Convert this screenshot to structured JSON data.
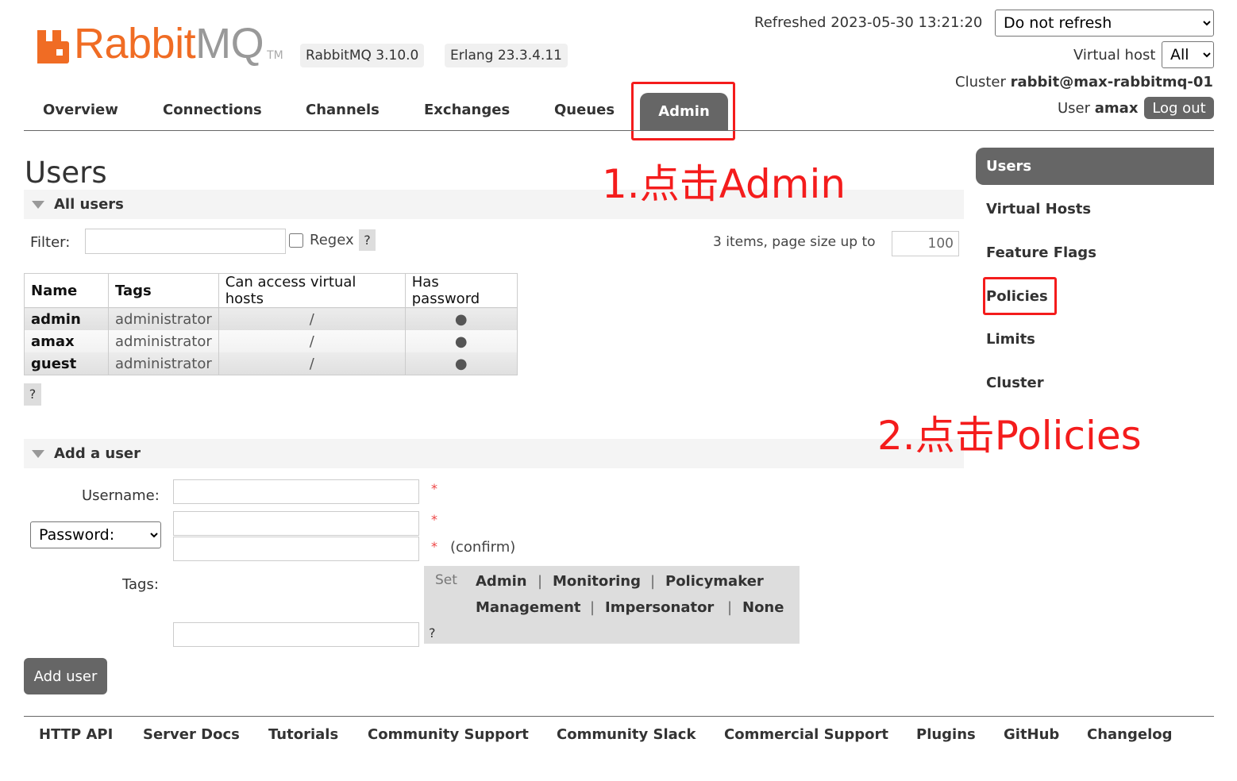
{
  "brand": {
    "name_a": "Rabbit",
    "name_b": "MQ",
    "tm": "TM"
  },
  "versions": {
    "rabbitmq": "RabbitMQ 3.10.0",
    "erlang": "Erlang 23.3.4.11"
  },
  "header": {
    "refreshed_label": "Refreshed 2023-05-30 13:21:20",
    "refresh_option": "Do not refresh",
    "vhost_label": "Virtual host",
    "vhost_option": "All",
    "cluster_label": "Cluster",
    "cluster_name": "rabbit@max-rabbitmq-01",
    "user_label": "User",
    "user_name": "amax",
    "logout_label": "Log out"
  },
  "tabs": [
    "Overview",
    "Connections",
    "Channels",
    "Exchanges",
    "Queues",
    "Admin"
  ],
  "page_title": "Users",
  "all_users": {
    "section_label": "All users",
    "filter_label": "Filter:",
    "regex_label": "Regex",
    "help": "?",
    "items_label": "3 items, page size up to",
    "page_size": "100",
    "columns": [
      "Name",
      "Tags",
      "Can access virtual hosts",
      "Has password"
    ],
    "rows": [
      {
        "name": "admin",
        "tags": "administrator",
        "vhosts": "/",
        "has_password": "●"
      },
      {
        "name": "amax",
        "tags": "administrator",
        "vhosts": "/",
        "has_password": "●"
      },
      {
        "name": "guest",
        "tags": "administrator",
        "vhosts": "/",
        "has_password": "●"
      }
    ]
  },
  "add_user": {
    "section_label": "Add a user",
    "username_label": "Username:",
    "password_option": "Password:",
    "required": "*",
    "confirm_label": "(confirm)",
    "tags_label": "Tags:",
    "set_label": "Set",
    "tag_options": [
      "Admin",
      "Monitoring",
      "Policymaker",
      "Management",
      "Impersonator",
      "None"
    ],
    "sep": "|",
    "help": "?",
    "submit_label": "Add user"
  },
  "side_nav": [
    "Users",
    "Virtual Hosts",
    "Feature Flags",
    "Policies",
    "Limits",
    "Cluster"
  ],
  "annotations": {
    "step1": "1.点击Admin",
    "step2": "2.点击Policies"
  },
  "footer_links": [
    "HTTP API",
    "Server Docs",
    "Tutorials",
    "Community Support",
    "Community Slack",
    "Commercial Support",
    "Plugins",
    "GitHub",
    "Changelog"
  ],
  "colors": {
    "brand_orange": "#f06c24",
    "nav_dark": "#666666",
    "annotation_red": "#f41c1c"
  }
}
